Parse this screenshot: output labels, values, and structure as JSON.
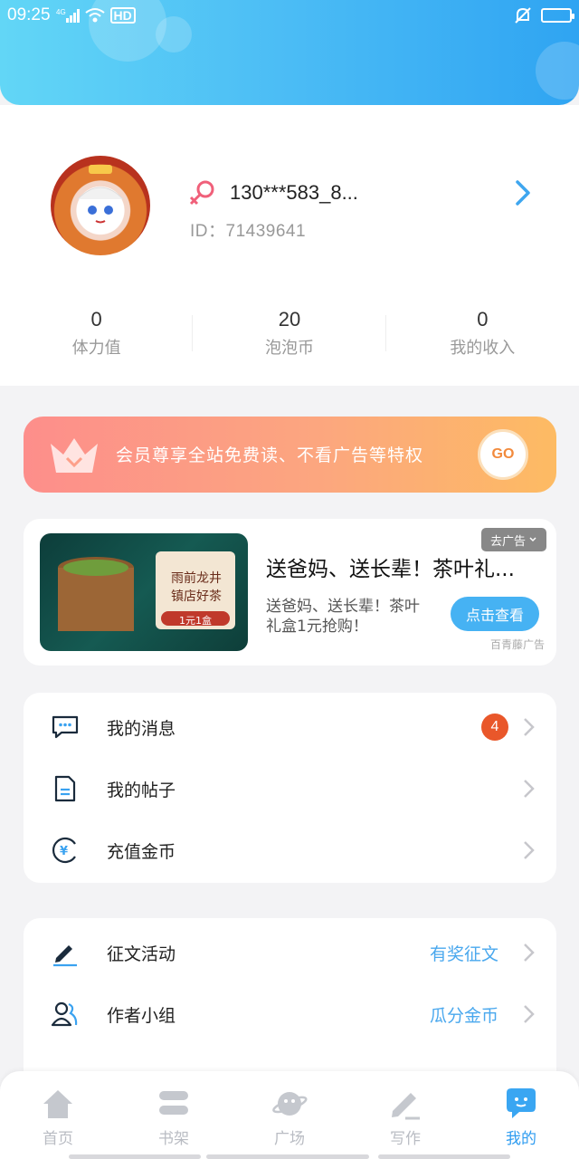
{
  "status_bar": {
    "time": "09:25",
    "network": "4G",
    "hd": "HD"
  },
  "profile": {
    "username": "130***583_8...",
    "user_id": "ID：71439641",
    "stats": [
      {
        "value": "0",
        "label": "体力值"
      },
      {
        "value": "20",
        "label": "泡泡币"
      },
      {
        "value": "0",
        "label": "我的收入"
      }
    ]
  },
  "vip_banner": {
    "text": "会员尊享全站免费读、不看广告等特权",
    "button": "GO"
  },
  "ad": {
    "image_text": "雨前龙井\n镇店好茶",
    "image_price": "1元1盒",
    "title": "送爸妈、送长辈！茶叶礼...",
    "description": "送爸妈、送长辈！茶叶礼盒1元抢购！",
    "remove_label": "去广告",
    "cta_label": "点击查看",
    "source": "百青藤广告"
  },
  "menu_group_1": [
    {
      "label": "我的消息",
      "icon": "message-icon",
      "badge": "4"
    },
    {
      "label": "我的帖子",
      "icon": "document-icon"
    },
    {
      "label": "充值金币",
      "icon": "yuan-coin-icon"
    }
  ],
  "menu_group_2": [
    {
      "label": "征文活动",
      "icon": "pen-icon",
      "extra": "有奖征文"
    },
    {
      "label": "作者小组",
      "icon": "group-icon",
      "extra": "瓜分金币"
    }
  ],
  "tabs": [
    {
      "label": "首页",
      "icon": "home-icon"
    },
    {
      "label": "书架",
      "icon": "bookshelf-icon"
    },
    {
      "label": "广场",
      "icon": "planet-icon"
    },
    {
      "label": "写作",
      "icon": "write-icon"
    },
    {
      "label": "我的",
      "icon": "chat-bubble-icon",
      "active": true
    }
  ],
  "colors": {
    "accent": "#2e9cf0",
    "badge": "#e9572a",
    "link": "#4aa8ee"
  }
}
